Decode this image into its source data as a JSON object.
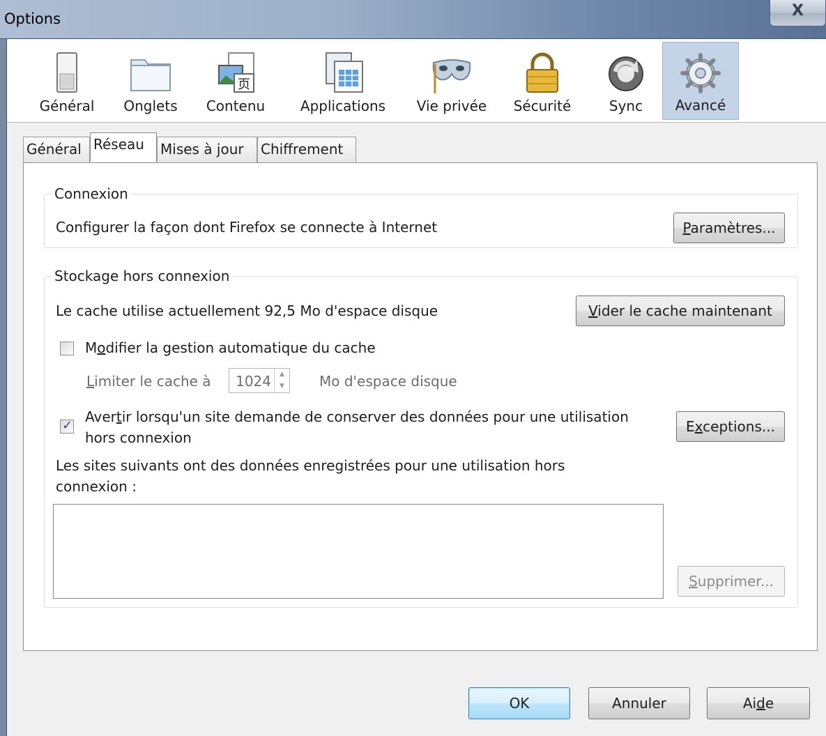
{
  "window": {
    "title": "Options",
    "close_glyph": "X"
  },
  "panes": [
    {
      "label": "Général",
      "icon": "general-switch-icon"
    },
    {
      "label": "Onglets",
      "icon": "tabs-folder-icon"
    },
    {
      "label": "Contenu",
      "icon": "content-image-icon"
    },
    {
      "label": "Applications",
      "icon": "applications-window-icon"
    },
    {
      "label": "Vie privée",
      "icon": "privacy-mask-icon"
    },
    {
      "label": "Sécurité",
      "icon": "security-lock-icon"
    },
    {
      "label": "Sync",
      "icon": "sync-arrows-icon"
    },
    {
      "label": "Avancé",
      "icon": "advanced-gear-icon"
    }
  ],
  "active_pane": "Avancé",
  "tabs": [
    "Général",
    "Réseau",
    "Mises à jour",
    "Chiffrement"
  ],
  "active_tab": "Réseau",
  "connexion": {
    "legend": "Connexion",
    "description": "Configurer la façon dont Firefox se connecte à Internet",
    "settings_button": {
      "accel": "P",
      "rest": "aramètres..."
    }
  },
  "offline": {
    "legend": "Stockage hors connexion",
    "cache_usage": "Le cache utilise actuellement 92,5 Mo d'espace disque",
    "clear_button": {
      "accel": "V",
      "rest": "ider le cache maintenant"
    },
    "override_checkbox": {
      "pre": "M",
      "accel": "o",
      "post": "difier la gestion automatique du cache",
      "checked": false
    },
    "limit_label": {
      "accel": "L",
      "rest": "imiter le cache à"
    },
    "limit_value": "1024",
    "limit_unit": "Mo d'espace disque",
    "warn_checkbox": {
      "pre": "Aver",
      "accel": "t",
      "post": "ir lorsqu'un site demande de conserver des données pour une utilisation",
      "line2": "hors connexion",
      "checked": true
    },
    "exceptions_button": {
      "pre": "E",
      "accel": "x",
      "post": "ceptions..."
    },
    "sites_label_line1": "Les sites suivants ont des données enregistrées pour une utilisation hors",
    "sites_label_line2": "connexion :",
    "sites": [],
    "remove_button": {
      "accel": "S",
      "rest": "upprimer..."
    }
  },
  "footer": {
    "ok": "OK",
    "cancel": "Annuler",
    "help": {
      "pre": "Ai",
      "accel": "d",
      "post": "e"
    }
  }
}
